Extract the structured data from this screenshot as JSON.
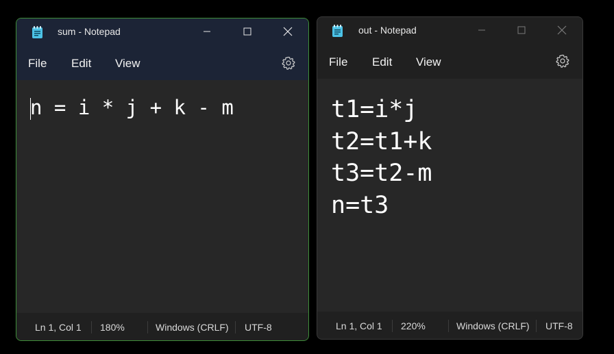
{
  "left_window": {
    "title": "sum - Notepad",
    "menu": {
      "file": "File",
      "edit": "Edit",
      "view": "View"
    },
    "content": "n = i * j + k - m",
    "status": {
      "position": "Ln 1, Col 1",
      "zoom": "180%",
      "line_ending": "Windows (CRLF)",
      "encoding": "UTF-8"
    }
  },
  "right_window": {
    "title": "out - Notepad",
    "menu": {
      "file": "File",
      "edit": "Edit",
      "view": "View"
    },
    "content": "t1=i*j\nt2=t1+k\nt3=t2-m\nn=t3",
    "status": {
      "position": "Ln 1, Col 1",
      "zoom": "220%",
      "line_ending": "Windows (CRLF)",
      "encoding": "UTF-8"
    }
  },
  "icons": {
    "app": "notepad-icon",
    "minimize": "minimize-icon",
    "maximize": "maximize-icon",
    "close": "close-icon",
    "settings": "gear-icon"
  },
  "colors": {
    "active_border": "#3f8f3a",
    "active_titlebar": "#1c2436",
    "inactive_titlebar": "#202020",
    "editor_bg": "#272727",
    "notepad_icon": "#4cc2e6"
  }
}
